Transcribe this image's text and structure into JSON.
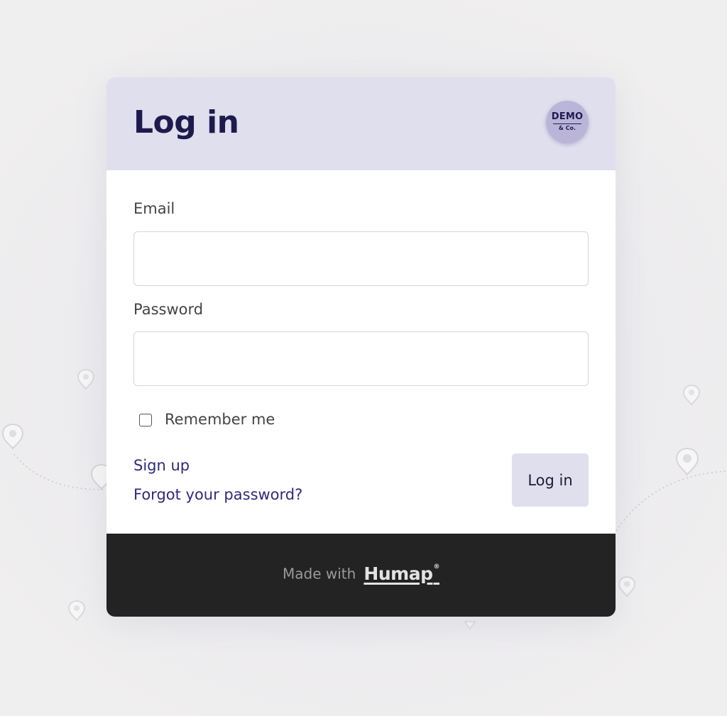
{
  "login_card": {
    "title": "Log in",
    "logo": {
      "main_text": "DEMO",
      "sub_text": "& Co."
    },
    "email": {
      "label": "Email",
      "value": "",
      "placeholder": ""
    },
    "password": {
      "label": "Password",
      "value": "",
      "placeholder": ""
    },
    "remember_me": {
      "label": "Remember me",
      "checked": false
    },
    "links": {
      "sign_up": "Sign up",
      "forgot_password": "Forgot your password?"
    },
    "submit_label": "Log in"
  },
  "footer": {
    "made_with": "Made with",
    "brand": "Humap",
    "brand_mark": "®"
  },
  "colors": {
    "page_background": "#efeeee",
    "header_background": "#e0dfed",
    "title_text": "#1f1a4e",
    "link_text": "#2f2a7a",
    "button_background": "#e0dfed",
    "footer_background": "#232323",
    "logo_badge": "#bab5d8"
  },
  "icons": {
    "background_pins": "map-pin-icon",
    "checkbox": "checkbox-unchecked"
  }
}
